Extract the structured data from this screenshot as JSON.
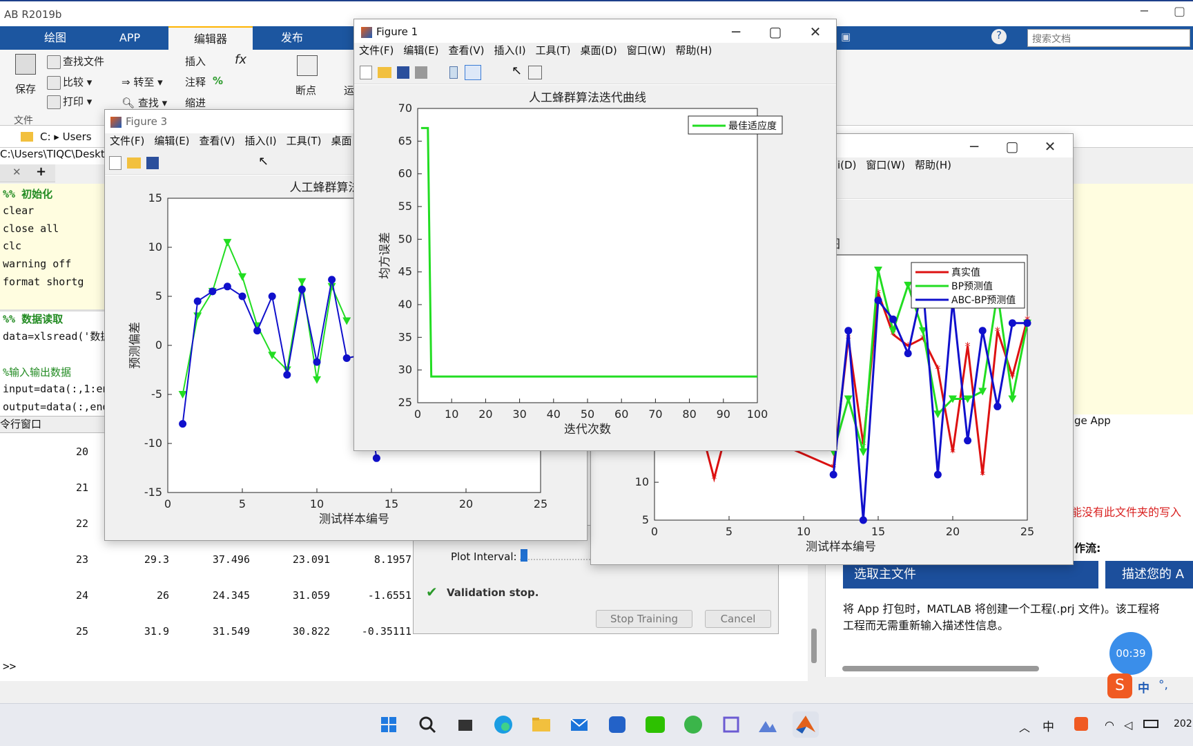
{
  "app_title": "AB R2019b",
  "ribbon": {
    "tabs": [
      "绘图",
      "APP",
      "编辑器",
      "发布"
    ]
  },
  "toolstrip": {
    "save": "保存",
    "find_files": "查找文件",
    "compare": "比较",
    "print": "打印",
    "goto": "转至",
    "find": "查找",
    "insert": "插入",
    "comment": "注释",
    "indent": "缩进",
    "breakpoint": "断点",
    "run": "运",
    "file_group": "文件"
  },
  "search": {
    "placeholder": "搜索文档"
  },
  "address": {
    "path": "C:  ▸  Users",
    "full_path": "C:\\Users\\TIQC\\Deskt"
  },
  "editor": {
    "lines": [
      {
        "t": "%% 初始化",
        "c": "#228b22",
        "b": true
      },
      {
        "t": "clear",
        "c": "#111"
      },
      {
        "t": "close all",
        "c": "#111"
      },
      {
        "t": "clc",
        "c": "#111"
      },
      {
        "t": "warning off",
        "c": "#111"
      },
      {
        "t": "format shortg",
        "c": "#111"
      },
      {
        "t": "",
        "c": "#111"
      },
      {
        "t": "%% 数据读取",
        "c": "#228b22",
        "b": true
      },
      {
        "t": "data=xlsread('数据",
        "c": "#111"
      },
      {
        "t": "",
        "c": "#111"
      },
      {
        "t": "%输入输出数据",
        "c": "#228b22"
      },
      {
        "t": "input=data(:,1:en",
        "c": "#111"
      },
      {
        "t": "output=data(:,end",
        "c": "#111"
      }
    ]
  },
  "cmd": {
    "title": "令行窗口",
    "rows": [
      [
        "20",
        "",
        "",
        "",
        ""
      ],
      [
        "21",
        "",
        "",
        "",
        ""
      ],
      [
        "22",
        "",
        "",
        "",
        ""
      ],
      [
        "23",
        "29.3",
        "37.496",
        "23.091",
        "8.1957"
      ],
      [
        "24",
        "26",
        "24.345",
        "31.059",
        "-1.6551"
      ],
      [
        "25",
        "31.9",
        "31.549",
        "30.822",
        "-0.35111"
      ]
    ],
    "prompt": ">>"
  },
  "nntrain": {
    "plot_interval": "Plot Interval:",
    "status": "Validation stop.",
    "stop": "Stop Training",
    "cancel": "Cancel"
  },
  "rightpanel": {
    "error": "能没有此文件夹的写入",
    "workflow": "作流:",
    "step1": "选取主文件",
    "step2": "描述您的 A",
    "desc1": "将 App 打包时，MATLAB 将创建一个工程(.prj 文件)。该工程将",
    "desc2": "工程而无需重新输入描述性信息。",
    "package_app": "ge App"
  },
  "timer": "00:39",
  "figure1": {
    "title": "Figure 1",
    "menu": [
      "文件(F)",
      "编辑(E)",
      "查看(V)",
      "插入(I)",
      "工具(T)",
      "桌面(D)",
      "窗口(W)",
      "帮助(H)"
    ]
  },
  "figure3": {
    "title": "Figure 3",
    "menu": [
      "文件(F)",
      "编辑(E)",
      "查看(V)",
      "插入(I)",
      "工具(T)",
      "桌面"
    ]
  },
  "figure2": {
    "menu": [
      "i(D)",
      "窗口(W)",
      "帮助(H)"
    ]
  },
  "ime": {
    "lang": "中",
    "punct": "°,"
  },
  "clock": "202",
  "chart_data": [
    {
      "type": "line",
      "title": "人工蜂群算法迭代曲线",
      "xlabel": "迭代次数",
      "ylabel": "均方误差",
      "xlim": [
        0,
        100
      ],
      "ylim": [
        25,
        70
      ],
      "xticks": [
        0,
        10,
        20,
        30,
        40,
        50,
        60,
        70,
        80,
        90,
        100
      ],
      "yticks": [
        25,
        30,
        35,
        40,
        45,
        50,
        55,
        60,
        65,
        70
      ],
      "legend": "top-right",
      "series": [
        {
          "name": "最佳适应度",
          "color": "#22dd22",
          "x": [
            1,
            2,
            3,
            4,
            100
          ],
          "y": [
            67,
            67,
            67,
            29,
            29
          ]
        }
      ]
    },
    {
      "type": "line",
      "title": "人工蜂群算法优化前后的BP神经",
      "xlabel": "测试样本编号",
      "ylabel": "预测偏差",
      "xlim": [
        0,
        25
      ],
      "ylim": [
        -15,
        15
      ],
      "xticks": [
        0,
        5,
        10,
        15,
        20,
        25
      ],
      "yticks": [
        -15,
        -10,
        -5,
        0,
        5,
        10,
        15
      ],
      "series": [
        {
          "color": "#22dd22",
          "x": [
            1,
            2,
            3,
            4,
            5,
            6,
            7,
            8,
            9,
            10,
            11,
            12
          ],
          "y": [
            -5,
            3,
            5.5,
            10.5,
            7,
            2,
            -1,
            -2.5,
            6.5,
            -3.5,
            6,
            2.5
          ]
        },
        {
          "color": "#1010cc",
          "x": [
            1,
            2,
            3,
            4,
            5,
            6,
            7,
            8,
            9,
            10,
            11,
            12,
            13,
            14
          ],
          "y": [
            -8,
            4.5,
            5.5,
            6,
            5,
            1.5,
            5,
            -3,
            5.7,
            -1.7,
            6.7,
            -1.3,
            -1,
            -11.5
          ]
        }
      ]
    },
    {
      "type": "line",
      "title": "神经网络预测值和真实值对比图",
      "xlabel": "测试样本编号",
      "xlim": [
        0,
        25
      ],
      "ylim": [
        5,
        40
      ],
      "xticks": [
        0,
        5,
        10,
        15,
        20,
        25
      ],
      "yticks": [
        5,
        10
      ],
      "legend": "top-right",
      "series": [
        {
          "name": "真实值",
          "color": "#dd1111",
          "x": [
            3,
            4,
            5,
            12,
            13,
            14,
            15,
            16,
            17,
            18,
            19,
            20,
            21,
            22,
            23,
            24,
            25
          ],
          "y": [
            18,
            10.5,
            18,
            12,
            29,
            15,
            35,
            29.5,
            28,
            29,
            25,
            14,
            28,
            11,
            30,
            24,
            31.5
          ]
        },
        {
          "name": "BP预测值",
          "color": "#22dd22",
          "x": [
            12,
            13,
            14,
            15,
            16,
            17,
            18,
            19,
            20,
            21,
            22,
            23,
            24,
            25
          ],
          "y": [
            14,
            21,
            14,
            38,
            30,
            36,
            30,
            19,
            21,
            21,
            22,
            35,
            21,
            31
          ]
        },
        {
          "name": "ABC-BP预测值",
          "color": "#1010cc",
          "x": [
            12,
            13,
            14,
            15,
            16,
            17,
            18,
            19,
            20,
            21,
            22,
            23,
            24,
            25
          ],
          "y": [
            11,
            30,
            5,
            34,
            31.5,
            27,
            36,
            11,
            34,
            15.5,
            30,
            20,
            31,
            31
          ]
        }
      ]
    }
  ]
}
